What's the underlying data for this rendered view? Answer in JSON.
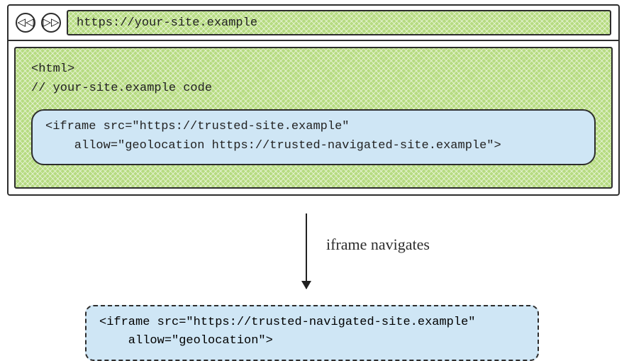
{
  "browser": {
    "url": "https://your-site.example",
    "back_glyph": "◁◁",
    "forward_glyph": "▷▷"
  },
  "page": {
    "line1": "<html>",
    "line2": "// your-site.example code"
  },
  "iframe1": {
    "line1": "<iframe src=\"https://trusted-site.example\"",
    "line2": "    allow=\"geolocation https://trusted-navigated-site.example\">"
  },
  "arrow": {
    "label": "iframe navigates"
  },
  "iframe2": {
    "line1": "<iframe src=\"https://trusted-navigated-site.example\"",
    "line2": "    allow=\"geolocation\">"
  }
}
